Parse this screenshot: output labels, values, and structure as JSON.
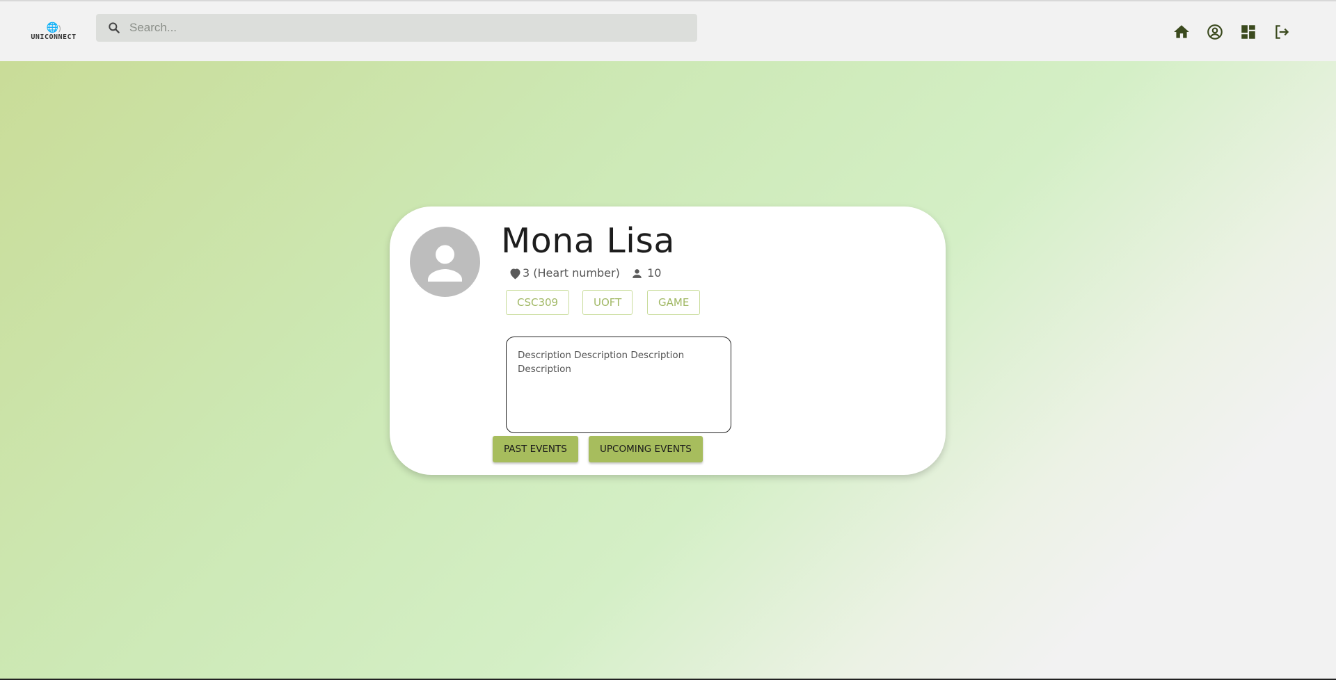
{
  "app": {
    "logo_text": "UNICONNECT"
  },
  "search": {
    "placeholder": "Search..."
  },
  "nav": {
    "icons": [
      "home-icon",
      "account-circle-icon",
      "dashboard-icon",
      "logout-icon"
    ],
    "icon_color": "#3b4a1e"
  },
  "profile": {
    "name": "Mona Lisa",
    "hearts": "3 (Heart number)",
    "followers": "10",
    "tags": [
      "CSC309",
      "UOFT",
      "GAME"
    ],
    "description": "Description Description Description Description",
    "buttons": {
      "past_events": "PAST EVENTS",
      "upcoming_events": "UPCOMING EVENTS"
    }
  },
  "colors": {
    "accent": "#a7bd5d",
    "tag_text": "#a1b865",
    "tag_border": "#c8dc9a",
    "avatar_bg": "#bdbdbd"
  }
}
